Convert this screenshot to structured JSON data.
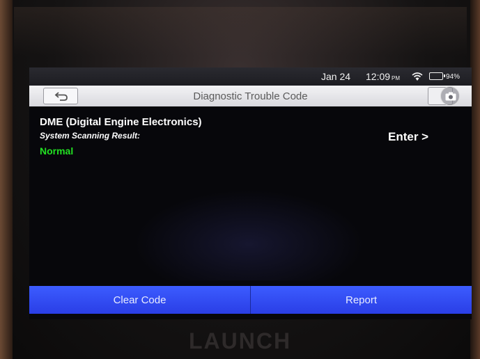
{
  "status_bar": {
    "date": "Jan 24",
    "time": "12:09",
    "ampm": "PM",
    "wifi_icon": "wifi-icon",
    "battery_icon": "battery-icon",
    "battery": "94%"
  },
  "header": {
    "back_icon": "back-arrow-icon",
    "title": "Diagnostic Trouble Code",
    "screenshot_icon": "camera-icon"
  },
  "main": {
    "system_name": "DME (Digital Engine Electronics)",
    "scan_label": "System Scanning Result:",
    "scan_result": "Normal",
    "scan_result_color": "#22e022",
    "enter_label": "Enter >"
  },
  "footer": {
    "clear_label": "Clear Code",
    "report_label": "Report",
    "button_color": "#2f47f0"
  },
  "device": {
    "brand": "LAUNCH"
  }
}
